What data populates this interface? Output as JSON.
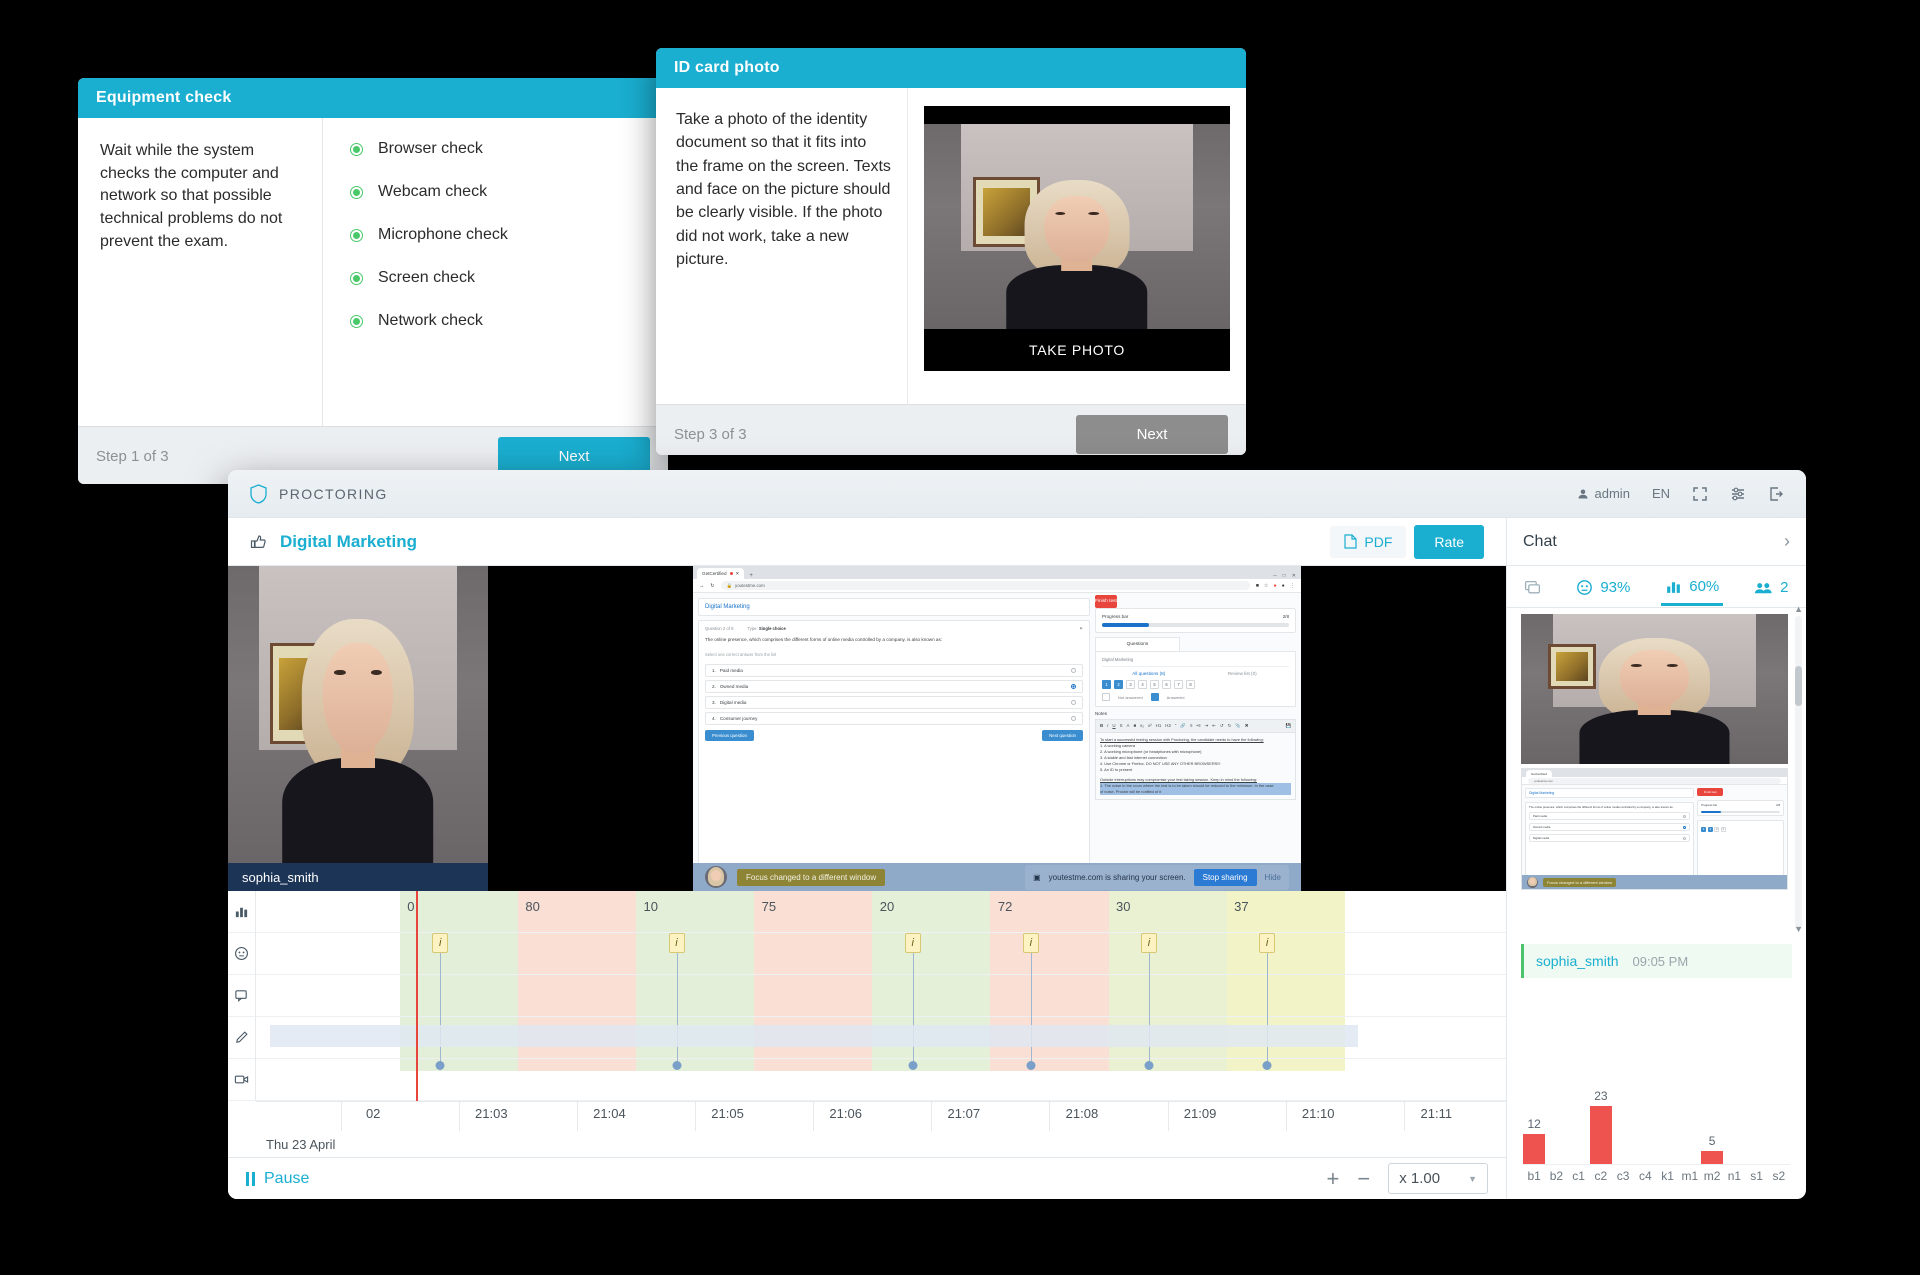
{
  "equipment_dialog": {
    "title": "Equipment check",
    "description": "Wait while the system checks the computer and network so that possible technical problems do not prevent the exam.",
    "checks": [
      {
        "label": "Browser check"
      },
      {
        "label": "Webcam check"
      },
      {
        "label": "Microphone check"
      },
      {
        "label": "Screen check"
      },
      {
        "label": "Network check"
      }
    ],
    "step": "Step 1 of 3",
    "next_label": "Next"
  },
  "id_dialog": {
    "title": "ID card photo",
    "description": "Take a photo of the identity document so that it fits into the frame on the screen. Texts and face on the picture should be clearly visible. If the photo did not work, take a new picture.",
    "take_photo_label": "TAKE PHOTO",
    "step": "Step 3 of 3",
    "next_label": "Next"
  },
  "proctoring": {
    "app_name": "PROCTORING",
    "user": "admin",
    "language": "EN",
    "exam_title": "Digital Marketing",
    "pdf_label": "PDF",
    "rate_label": "Rate",
    "chat_label": "Chat",
    "webcam_user": "sophia_smith",
    "pause_label": "Pause",
    "speed_value": "x 1.00",
    "date_label": "Thu 23 April",
    "stats": [
      {
        "icon": "comment-icon",
        "value": ""
      },
      {
        "icon": "face-icon",
        "value": "93%"
      },
      {
        "icon": "bar-chart-icon",
        "value": "60%"
      },
      {
        "icon": "people-icon",
        "value": "2"
      }
    ],
    "chat_message": {
      "user": "sophia_smith",
      "time": "09:05 PM"
    },
    "timeline": {
      "values": [
        "0",
        "80",
        "10",
        "75",
        "20",
        "72",
        "30",
        "37"
      ],
      "times": [
        "02",
        "21:03",
        "21:04",
        "21:05",
        "21:06",
        "21:07",
        "21:08",
        "21:09",
        "21:10",
        "21:11"
      ],
      "marker_label": "i"
    },
    "screen_capture": {
      "tab_title": "GetCertified",
      "url": "youtestme.com",
      "exam_heading": "Digital Marketing",
      "question_meta": "Question 2 of 8",
      "question_type_label": "Type:",
      "question_type": "Single choice",
      "question_text": "The online presence, which comprises the different forms of online media controlled by a company, is also known as:",
      "select_hint": "Select one correct answer from the list",
      "options": [
        {
          "n": "1.",
          "text": "Paid media",
          "selected": false
        },
        {
          "n": "2.",
          "text": "Owned media",
          "selected": true
        },
        {
          "n": "3.",
          "text": "Digital media",
          "selected": false
        },
        {
          "n": "4.",
          "text": "Consumer journey",
          "selected": false
        }
      ],
      "prev_label": "Previous question",
      "next_label": "Next question",
      "finish_label": "Finish test",
      "progress_label": "Progress bar",
      "progress_value": "2/8",
      "questions_tab": "Questions",
      "panel_exam": "Digital Marketing",
      "all_questions": "All questions (8)",
      "review_list": "Review list (0)",
      "q_numbers": [
        "1",
        "2",
        "3",
        "4",
        "5",
        "6",
        "7",
        "8"
      ],
      "legend_unanswered": "Not answered",
      "legend_answered": "Answered",
      "notes_label": "Notes",
      "notes_heading": "To start a successful testing session with Proctoring, the candidate needs to have the following:",
      "notes_items": [
        "1. A working camera",
        "2. A working microphone (or headphones with microphone)",
        "3. A stable and fast internet connection",
        "4. Use Chrome or Firefox. DO NOT USE ANY OTHER BROWSERS!!!",
        "5. An ID to present"
      ],
      "notes_heading2": "Outside interruptions may compromise your test taking session. Keep in mind the following:",
      "notes_items2": [
        "1. The noise in the room where the test is to be taken should be reduced to the minimum. In the case",
        "of noise, Proctor will be notified of it"
      ],
      "focus_alert": "Focus changed to a different window",
      "sharing_text": "youtestme.com is sharing your screen.",
      "stop_sharing": "Stop sharing",
      "hide_label": "Hide"
    }
  },
  "chart_data": {
    "type": "bar",
    "categories": [
      "b1",
      "b2",
      "c1",
      "c2",
      "c3",
      "c4",
      "k1",
      "m1",
      "m2",
      "n1",
      "s1",
      "s2"
    ],
    "values": [
      12,
      0,
      0,
      23,
      0,
      0,
      0,
      0,
      5,
      0,
      0,
      0
    ],
    "title": "",
    "xlabel": "",
    "ylabel": "",
    "ylim": [
      0,
      25
    ],
    "color": "#ef5350"
  },
  "timeline_chart": {
    "type": "bar",
    "categories": [
      "21:03",
      "21:04",
      "21:05",
      "21:06",
      "21:07",
      "21:08",
      "21:09",
      "21:10"
    ],
    "values": [
      0,
      80,
      10,
      75,
      20,
      72,
      30,
      37
    ],
    "band_colors": [
      "#e3efd8",
      "#fadfd5",
      "#e3efd8",
      "#fadfd5",
      "#e5f0d9",
      "#fadfd5",
      "#eaf1d2",
      "#f3f3c8"
    ],
    "title": "",
    "xlabel": "",
    "ylabel": ""
  },
  "colors": {
    "accent": "#1aaed0",
    "green": "#49c96a",
    "red": "#e8453c",
    "bar": "#ef5350"
  }
}
